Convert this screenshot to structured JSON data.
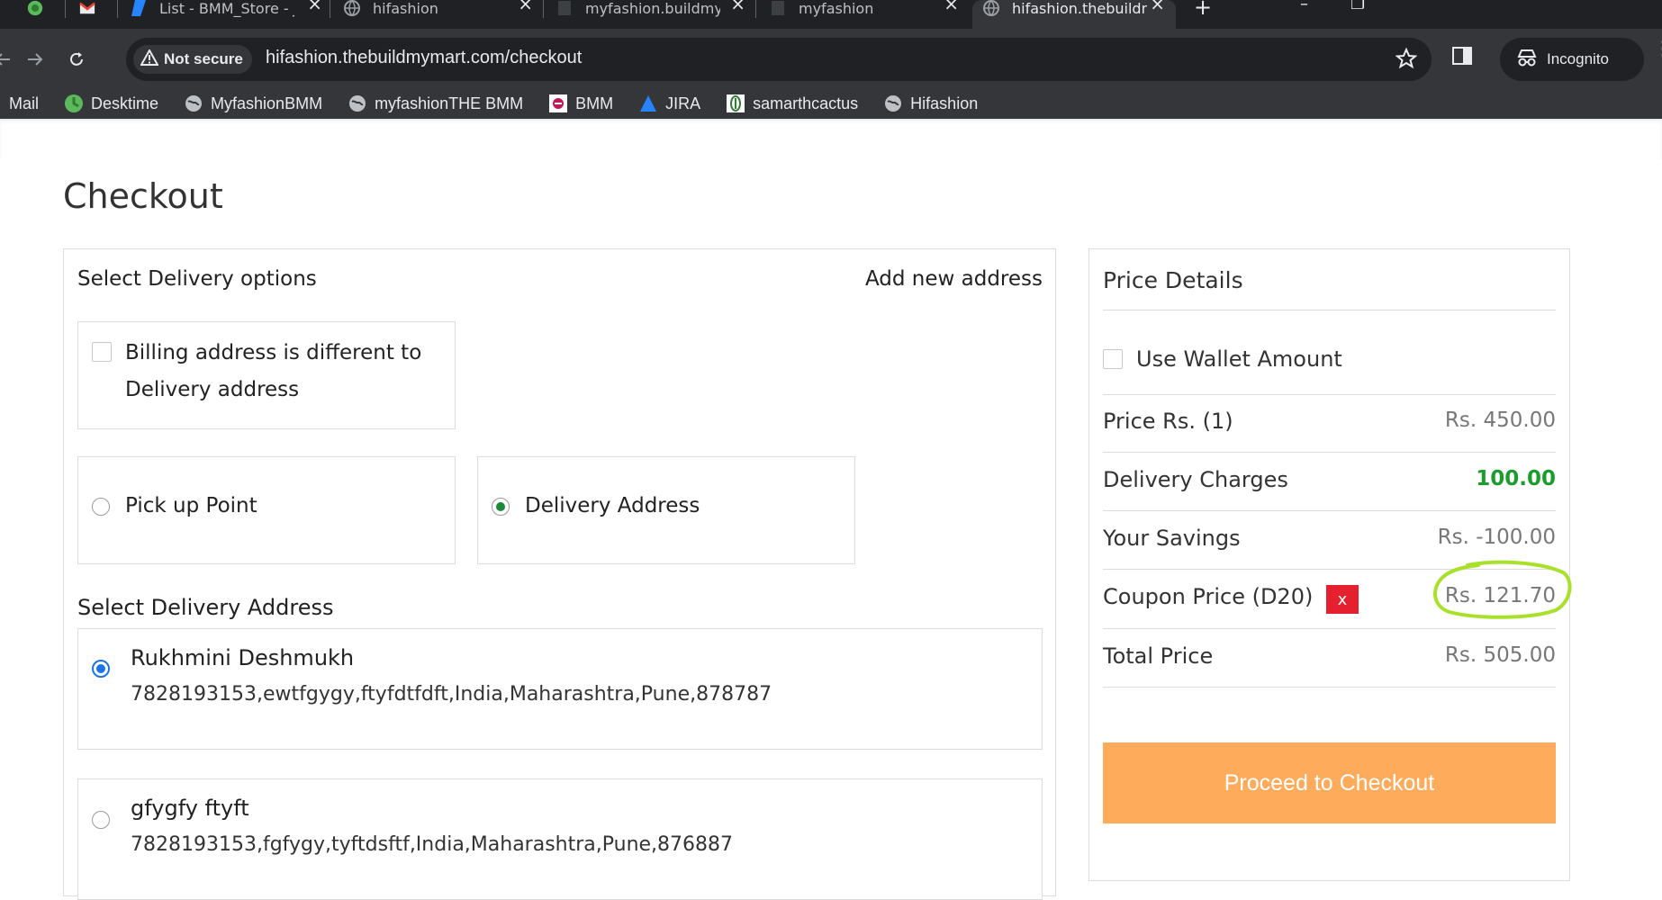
{
  "browser": {
    "tabs": [
      {
        "title": "",
        "active": false
      },
      {
        "title": "",
        "active": false
      },
      {
        "title": "List - BMM_Store - Jira",
        "active": false
      },
      {
        "title": "hifashion",
        "active": false
      },
      {
        "title": "myfashion.buildmymart",
        "active": false
      },
      {
        "title": "myfashion",
        "active": false
      },
      {
        "title": "hifashion.thebuildmymart",
        "active": true
      }
    ],
    "security_label": "Not secure",
    "url": "hifashion.thebuildmymart.com/checkout",
    "incognito_label": "Incognito",
    "bookmarks": [
      {
        "label": "Mail",
        "icon": "none"
      },
      {
        "label": "Desktime",
        "icon": "desktime-icon"
      },
      {
        "label": "MyfashionBMM",
        "icon": "globe-icon"
      },
      {
        "label": "myfashionTHE BMM",
        "icon": "globe-icon"
      },
      {
        "label": "BMM",
        "icon": "bmm-icon"
      },
      {
        "label": "JIRA",
        "icon": "jira-icon"
      },
      {
        "label": "samarthcactus",
        "icon": "cactus-icon"
      },
      {
        "label": "Hifashion",
        "icon": "globe-icon"
      }
    ]
  },
  "page": {
    "title": "Checkout",
    "delivery": {
      "section_title": "Select Delivery options",
      "add_new_address": "Add new address",
      "billing_different_line1": "Billing address is different to",
      "billing_different_line2": "Delivery address",
      "billing_different_checked": false,
      "pickup_label": "Pick up Point",
      "delivery_label": "Delivery Address",
      "selected_option": "Delivery Address"
    },
    "address": {
      "section_title": "Select Delivery Address",
      "list": [
        {
          "name": "Rukhmini Deshmukh",
          "detail": "7828193153,ewtfgygy,ftyfdtfdft,India,Maharashtra,Pune,878787",
          "selected": true
        },
        {
          "name": "gfygfy ftyft",
          "detail": "7828193153,fgfygy,tyftdsftf,India,Maharashtra,Pune,876887",
          "selected": false
        }
      ]
    },
    "price": {
      "title": "Price Details",
      "wallet_label": "Use Wallet Amount",
      "wallet_checked": false,
      "rows": [
        {
          "label": "Price Rs. (1)",
          "value": "Rs. 450.00"
        },
        {
          "label": "Delivery Charges",
          "value": "100.00"
        },
        {
          "label": "Your Savings",
          "value": "Rs. -100.00"
        },
        {
          "label": "Coupon Price (D20)",
          "value": "Rs. 121.70"
        },
        {
          "label": "Total Price",
          "value": "Rs. 505.00"
        }
      ],
      "coupon_remove_label": "x",
      "checkout_label": "Proceed to Checkout"
    }
  },
  "colors": {
    "accent_button": "#ffab5c",
    "positive_value": "#1a9c2e",
    "coupon_remove": "#e52130",
    "highlight_marker": "#a8e02a",
    "chrome_dark": "#202124",
    "chrome_toolbar": "#35363a"
  }
}
